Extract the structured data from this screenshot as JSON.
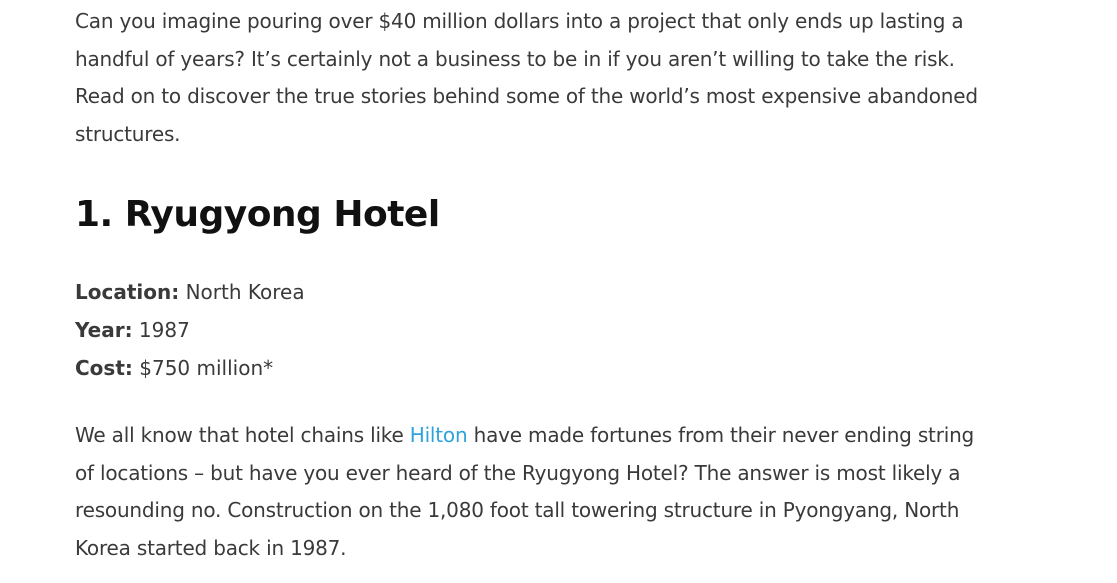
{
  "intro": {
    "text": "Can you imagine pouring over $40 million dollars into a project that only ends up lasting a handful of years? It’s certainly not a business to be in if you aren’t willing to take the risk. Read on to discover the true stories behind some of the world’s most expensive abandoned structures."
  },
  "section": {
    "title": "1. Ryugyong Hotel",
    "facts": [
      {
        "label": "Location:",
        "value": " North Korea"
      },
      {
        "label": "Year:",
        "value": " 1987"
      },
      {
        "label": "Cost:",
        "value": " $750 million*"
      }
    ],
    "body": {
      "before_link": "We all know that hotel chains like ",
      "link_text": "Hilton",
      "after_link": " have made fortunes from their never ending string of locations – but have you ever heard of the Ryugyong Hotel? The answer is most likely a resounding no. Construction on the 1,080 foot tall towering structure in Pyongyang, North Korea started back in 1987."
    }
  },
  "colors": {
    "text": "#3a3a3a",
    "heading": "#111111",
    "link": "#2ea3dc"
  }
}
